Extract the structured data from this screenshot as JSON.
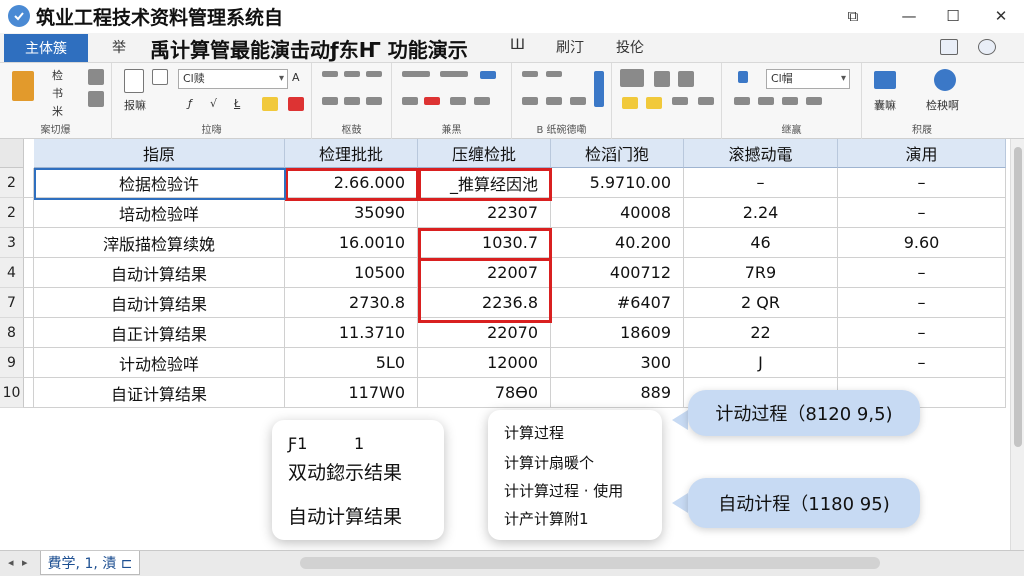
{
  "window": {
    "title": "筑业工程技术资料管理系统自",
    "controls": [
      "⧉",
      "—",
      "☐",
      "✕"
    ]
  },
  "tabs": {
    "main": "主体簇",
    "t1": "举",
    "headline": "禹计算管最能演击动ƒ东Ҥ  功能演示",
    "t2": "Ш",
    "t3": "刷汀",
    "t4": "投伦"
  },
  "ribbon": {
    "g1_items": [
      "检",
      "书",
      "米"
    ],
    "g1_label": "案切爆",
    "font_name": "Cl赎",
    "g2_items": [
      "报嘛",
      "ƒ",
      "√",
      "Ł"
    ],
    "g2_label": "拉嗨",
    "g3_label": "枢鼓",
    "g4_label": "兼黑",
    "g5_label": "B 纸碗德嘞",
    "font_name2": "Cl帽",
    "g6_label": "继赢",
    "g7_items": [
      "囊嘛",
      "检秧啊"
    ],
    "g7_label": "积屐"
  },
  "grid": {
    "headers": [
      "指原",
      "检理批批",
      "压缠检批",
      "检滔门狍",
      "滚撼动電",
      "演用"
    ],
    "rows": [
      {
        "num": "2",
        "cells": [
          "检据检验许",
          "2.66.000",
          "_推算经因池",
          "5.9710.00",
          "–",
          "–"
        ]
      },
      {
        "num": "2",
        "cells": [
          "培动检验咩",
          "35090",
          "22307",
          "40008",
          "2.24",
          "–"
        ]
      },
      {
        "num": "3",
        "cells": [
          "滓版描检算续娩",
          "16.0010",
          "1030.7",
          "40.200",
          "46",
          "9.60"
        ]
      },
      {
        "num": "4",
        "cells": [
          "自动计算结果",
          "10500",
          "22007",
          "400712",
          "7R9",
          "–"
        ]
      },
      {
        "num": "7",
        "cells": [
          "自动计算结果",
          "2730.8",
          "2236.8",
          "#6407",
          "2 QR",
          "–"
        ]
      },
      {
        "num": "8",
        "cells": [
          "自正计算结果",
          "11.3710",
          "22070",
          "18609",
          "22",
          "–"
        ]
      },
      {
        "num": "9",
        "cells": [
          "计动检验咩",
          "5L0",
          "12000",
          "300",
          "J",
          "–"
        ]
      },
      {
        "num": "10",
        "cells": [
          "自证计算结果",
          "117W0",
          "78Ɵ0",
          "889",
          "",
          ""
        ]
      }
    ]
  },
  "card_left": {
    "line1a": "Ƒ1",
    "line1b": "1",
    "line2": "双动鍃示结果",
    "line3": "自动计算结果"
  },
  "card_mid": {
    "lines": [
      "计算过程",
      "计算计扇暖个",
      "计计算过程 · 使用",
      "计产计算附1"
    ]
  },
  "bubbles": {
    "top": "计动过程（8120 9,5)",
    "bottom": "自动计程（1180 95)"
  },
  "sheet": {
    "tab": "費学, 1, 漬 ⊏",
    "nav_left": "◂",
    "nav_right": "▸"
  },
  "colors": {
    "accent": "#2f6fbf",
    "highlight": "#d92020",
    "bubble": "#c7daf3",
    "header": "#dce7f5"
  }
}
